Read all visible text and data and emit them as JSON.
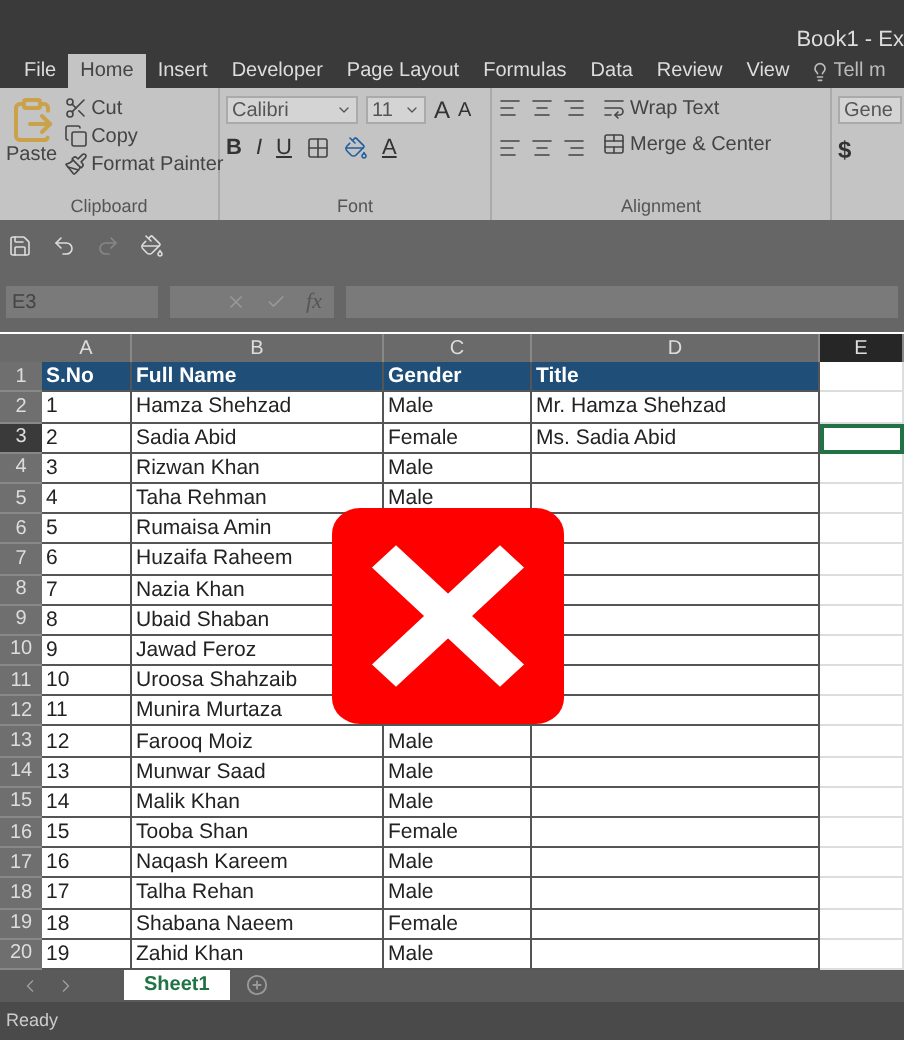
{
  "window": {
    "title": "Book1 - Ex"
  },
  "tabs": [
    {
      "label": "File",
      "selected": false
    },
    {
      "label": "Home",
      "selected": true
    },
    {
      "label": "Insert",
      "selected": false
    },
    {
      "label": "Developer",
      "selected": false
    },
    {
      "label": "Page Layout",
      "selected": false
    },
    {
      "label": "Formulas",
      "selected": false
    },
    {
      "label": "Data",
      "selected": false
    },
    {
      "label": "Review",
      "selected": false
    },
    {
      "label": "View",
      "selected": false
    }
  ],
  "tell_me": "Tell m",
  "ribbon": {
    "clipboard": {
      "paste": "Paste",
      "cut": "Cut",
      "copy": "Copy",
      "format_painter": "Format Painter",
      "label": "Clipboard"
    },
    "font": {
      "font_name": "Calibri",
      "font_size": "11",
      "grow": "A",
      "shrink": "A",
      "bold": "B",
      "italic": "I",
      "underline": "U",
      "color_button": "A",
      "label": "Font"
    },
    "alignment": {
      "wrap_text": "Wrap Text",
      "merge_center": "Merge & Center",
      "label": "Alignment"
    },
    "number": {
      "format": "Gene",
      "currency": "$"
    }
  },
  "name_box": "E3",
  "formula_bar": {
    "fx": "fx"
  },
  "columns": [
    {
      "label": "A",
      "selected": false
    },
    {
      "label": "B",
      "selected": false
    },
    {
      "label": "C",
      "selected": false
    },
    {
      "label": "D",
      "selected": false
    },
    {
      "label": "E",
      "selected": true
    }
  ],
  "rows": [
    {
      "number": "1",
      "selected": false,
      "kind": "header",
      "cells": [
        "S.No",
        "Full Name",
        "Gender",
        "Title"
      ]
    },
    {
      "number": "2",
      "selected": false,
      "kind": "data",
      "cells": [
        "1",
        "Hamza Shehzad",
        "Male",
        "Mr. Hamza Shehzad"
      ]
    },
    {
      "number": "3",
      "selected": true,
      "kind": "data",
      "cells": [
        "2",
        "Sadia Abid",
        "Female",
        "Ms. Sadia Abid"
      ]
    },
    {
      "number": "4",
      "selected": false,
      "kind": "data",
      "cells": [
        "3",
        "Rizwan Khan",
        "Male",
        null
      ]
    },
    {
      "number": "5",
      "selected": false,
      "kind": "data",
      "cells": [
        "4",
        "Taha Rehman",
        "Male",
        null
      ]
    },
    {
      "number": "6",
      "selected": false,
      "kind": "data",
      "cells": [
        "5",
        "Rumaisa Amin",
        null,
        null
      ]
    },
    {
      "number": "7",
      "selected": false,
      "kind": "data",
      "cells": [
        "6",
        "Huzaifa Raheem",
        null,
        null
      ]
    },
    {
      "number": "8",
      "selected": false,
      "kind": "data",
      "cells": [
        "7",
        "Nazia Khan",
        null,
        null
      ]
    },
    {
      "number": "9",
      "selected": false,
      "kind": "data",
      "cells": [
        "8",
        "Ubaid Shaban",
        null,
        null
      ]
    },
    {
      "number": "10",
      "selected": false,
      "kind": "data",
      "cells": [
        "9",
        "Jawad Feroz",
        null,
        null
      ]
    },
    {
      "number": "11",
      "selected": false,
      "kind": "data",
      "cells": [
        "10",
        "Uroosa Shahzaib",
        null,
        null
      ]
    },
    {
      "number": "12",
      "selected": false,
      "kind": "data",
      "cells": [
        "11",
        "Munira Murtaza",
        null,
        null
      ]
    },
    {
      "number": "13",
      "selected": false,
      "kind": "data",
      "cells": [
        "12",
        "Farooq Moiz",
        "Male",
        null
      ]
    },
    {
      "number": "14",
      "selected": false,
      "kind": "data",
      "cells": [
        "13",
        "Munwar Saad",
        "Male",
        null
      ]
    },
    {
      "number": "15",
      "selected": false,
      "kind": "data",
      "cells": [
        "14",
        "Malik Khan",
        "Male",
        null
      ]
    },
    {
      "number": "16",
      "selected": false,
      "kind": "data",
      "cells": [
        "15",
        "Tooba Shan",
        "Female",
        null
      ]
    },
    {
      "number": "17",
      "selected": false,
      "kind": "data",
      "cells": [
        "16",
        "Naqash Kareem",
        "Male",
        null
      ]
    },
    {
      "number": "18",
      "selected": false,
      "kind": "data",
      "cells": [
        "17",
        "Talha Rehan",
        "Male",
        null
      ]
    },
    {
      "number": "19",
      "selected": false,
      "kind": "data",
      "cells": [
        "18",
        "Shabana Naeem",
        "Female",
        null
      ]
    },
    {
      "number": "20",
      "selected": false,
      "kind": "data",
      "cells": [
        "19",
        "Zahid Khan",
        "Male",
        null
      ]
    }
  ],
  "sheet_tabs": [
    {
      "label": "Sheet1",
      "selected": true
    }
  ],
  "status_bar": "Ready"
}
